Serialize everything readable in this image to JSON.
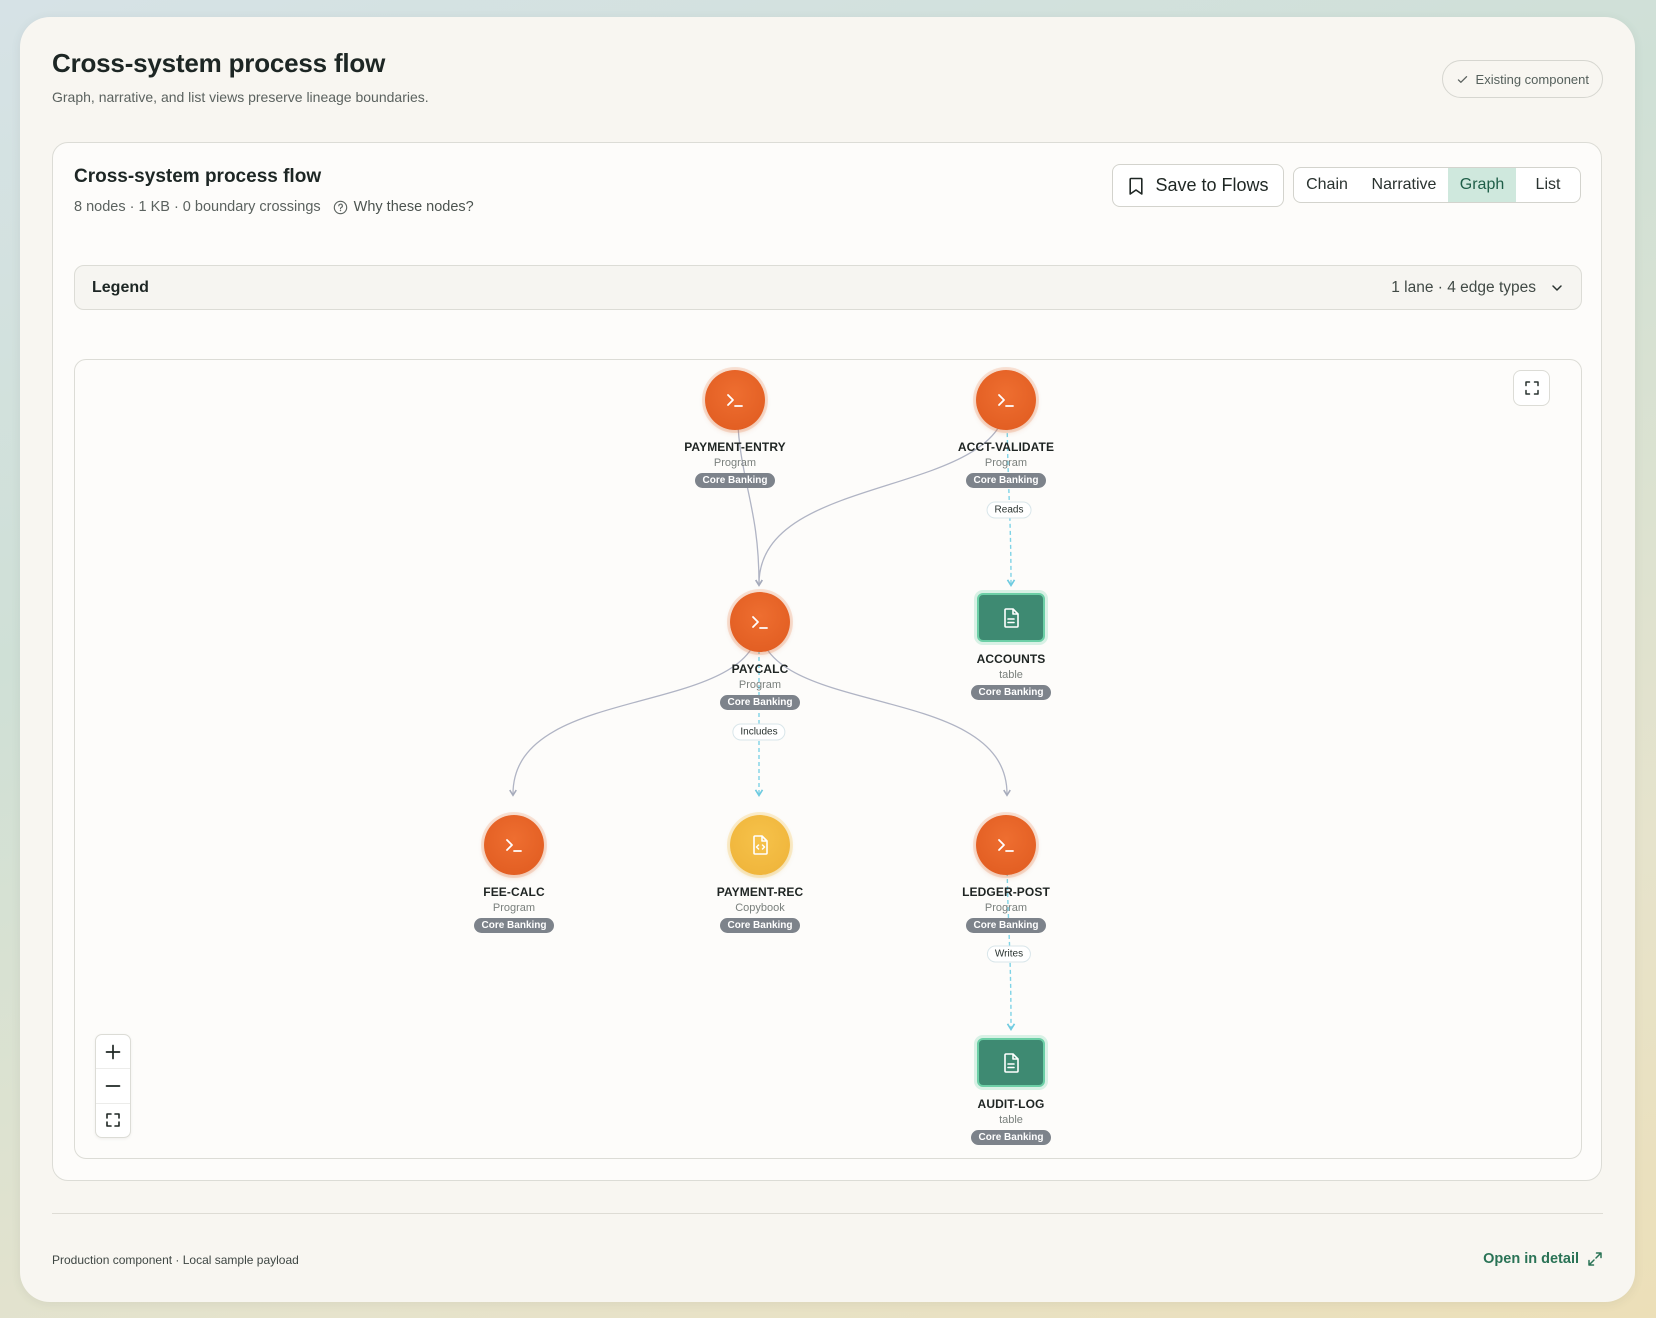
{
  "header": {
    "title": "Cross-system process flow",
    "subtitle": "Graph, narrative, and list views preserve lineage boundaries.",
    "existing_badge": "Existing component"
  },
  "panel": {
    "title": "Cross-system process flow",
    "meta": "8 nodes · 1 KB · 0 boundary crossings",
    "why_label": "Why these nodes?",
    "save_label": "Save to Flows",
    "tabs": [
      {
        "label": "Chain",
        "active": false
      },
      {
        "label": "Narrative",
        "active": false
      },
      {
        "label": "Graph",
        "active": true
      },
      {
        "label": "List",
        "active": false
      }
    ],
    "legend": {
      "title": "Legend",
      "summary": "1 lane · 4 edge types"
    }
  },
  "graph": {
    "nodes": [
      {
        "id": "payment-entry",
        "name": "PAYMENT-ENTRY",
        "type": "Program",
        "system": "Core Banking",
        "kind": "program",
        "icon": "terminal-icon"
      },
      {
        "id": "acct-validate",
        "name": "ACCT-VALIDATE",
        "type": "Program",
        "system": "Core Banking",
        "kind": "program",
        "icon": "terminal-icon"
      },
      {
        "id": "paycalc",
        "name": "PAYCALC",
        "type": "Program",
        "system": "Core Banking",
        "kind": "program",
        "icon": "terminal-icon"
      },
      {
        "id": "accounts",
        "name": "ACCOUNTS",
        "type": "table",
        "system": "Core Banking",
        "kind": "table",
        "icon": "document-icon"
      },
      {
        "id": "fee-calc",
        "name": "FEE-CALC",
        "type": "Program",
        "system": "Core Banking",
        "kind": "program",
        "icon": "terminal-icon"
      },
      {
        "id": "payment-rec",
        "name": "PAYMENT-REC",
        "type": "Copybook",
        "system": "Core Banking",
        "kind": "copybook",
        "icon": "code-file-icon"
      },
      {
        "id": "ledger-post",
        "name": "LEDGER-POST",
        "type": "Program",
        "system": "Core Banking",
        "kind": "program",
        "icon": "terminal-icon"
      },
      {
        "id": "audit-log",
        "name": "AUDIT-LOG",
        "type": "table",
        "system": "Core Banking",
        "kind": "table",
        "icon": "document-icon"
      }
    ],
    "edge_labels": {
      "reads": "Reads",
      "includes": "Includes",
      "writes": "Writes"
    },
    "colors": {
      "program": "#e4612a",
      "copybook": "#f2b941",
      "table": "#3e8a72",
      "call_edge": "#b0b4c4",
      "data_edge": "#7fd3e6"
    }
  },
  "footer": {
    "text": "Production component · Local sample payload",
    "open_detail": "Open in detail"
  }
}
